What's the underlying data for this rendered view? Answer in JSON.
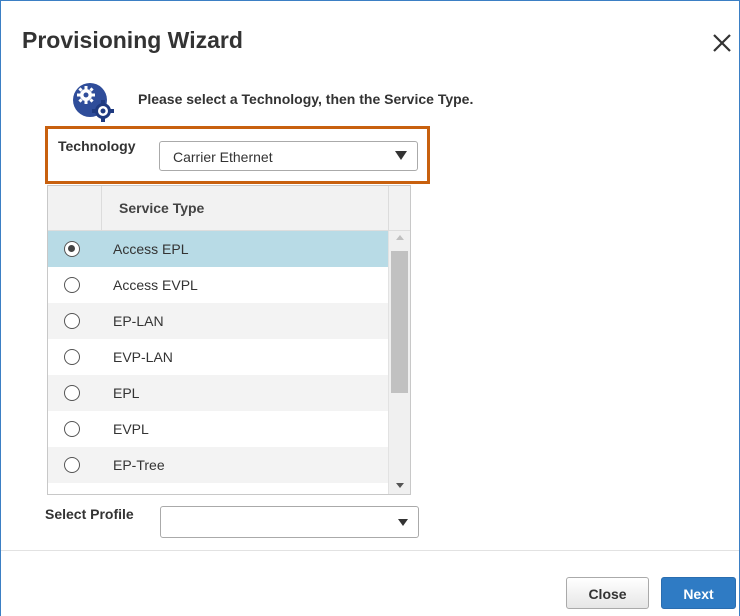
{
  "dialog": {
    "title": "Provisioning Wizard",
    "close_icon": "close-x-icon",
    "gear_icon": "gears-icon",
    "instruction": "Please select a Technology, then the Service Type.",
    "highlight_color": "#c8600e"
  },
  "technology": {
    "label": "Technology",
    "selected": "Carrier Ethernet"
  },
  "service_table": {
    "header": "Service Type",
    "rows": [
      {
        "name": "Access EPL",
        "selected": true
      },
      {
        "name": "Access EVPL",
        "selected": false
      },
      {
        "name": "EP-LAN",
        "selected": false
      },
      {
        "name": "EVP-LAN",
        "selected": false
      },
      {
        "name": "EPL",
        "selected": false
      },
      {
        "name": "EVPL",
        "selected": false
      },
      {
        "name": "EP-Tree",
        "selected": false
      }
    ]
  },
  "profile": {
    "label": "Select Profile",
    "selected": ""
  },
  "buttons": {
    "close": "Close",
    "next": "Next"
  },
  "colors": {
    "selected_row": "#b8dbe6",
    "primary_button": "#2f7bc4"
  }
}
